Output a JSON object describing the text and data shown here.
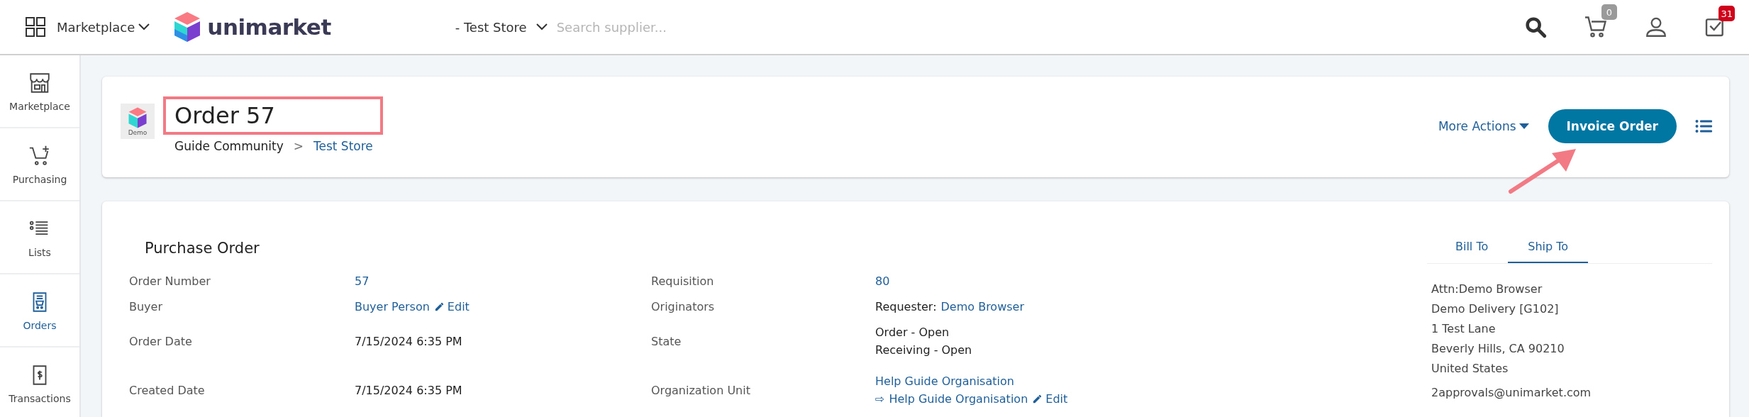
{
  "topbar": {
    "app_menu": "Marketplace",
    "brand": "unimarket",
    "store": "- Test Store",
    "search": {
      "placeholder": "Search supplier..."
    },
    "cart_count": "0",
    "task_count": "31"
  },
  "sidebar": {
    "items": [
      {
        "label": "Marketplace",
        "kind": "store",
        "selected": false
      },
      {
        "label": "Purchasing",
        "kind": "cart",
        "selected": false
      },
      {
        "label": "Lists",
        "kind": "list",
        "selected": false
      },
      {
        "label": "Orders",
        "kind": "orders",
        "selected": true
      },
      {
        "label": "Transactions",
        "kind": "money",
        "selected": false
      }
    ]
  },
  "header": {
    "logo_caption": "Demo",
    "title": "Order 57",
    "title_highlighted": true,
    "breadcrumb": [
      {
        "text": "Guide Community",
        "kind": "text"
      },
      {
        "text": ">",
        "kind": "separator"
      },
      {
        "text": "Test Store",
        "kind": "link"
      }
    ],
    "more_actions": "More Actions",
    "primary_button": "Invoice Order",
    "arrow_annotation": true
  },
  "details": {
    "heading": "Purchase Order",
    "columns": [
      {
        "fields": [
          {
            "label": "Order Number",
            "lines": [
              [
                {
                  "text": "57",
                  "kind": "link"
                }
              ]
            ]
          },
          {
            "label": "Buyer",
            "lines": [
              [
                {
                  "text": "Buyer Person",
                  "kind": "link"
                },
                {
                  "text": "Edit",
                  "kind": "edit"
                }
              ]
            ]
          },
          {
            "label": "Order Date",
            "lines": [
              [
                {
                  "text": "7/15/2024 6:35 PM",
                  "kind": "text"
                }
              ]
            ]
          },
          {
            "label": "Created Date",
            "lines": [
              [
                {
                  "text": "7/15/2024 6:35 PM",
                  "kind": "text"
                }
              ]
            ]
          }
        ]
      },
      {
        "fields": [
          {
            "label": "Requisition",
            "lines": [
              [
                {
                  "text": "80",
                  "kind": "link"
                }
              ]
            ]
          },
          {
            "label": "Originators",
            "lines": [
              [
                {
                  "text": "Requester:",
                  "kind": "text"
                },
                {
                  "text": "Demo Browser",
                  "kind": "link"
                }
              ]
            ]
          },
          {
            "label": "State",
            "lines": [
              [
                {
                  "text": "Order - Open",
                  "kind": "text"
                }
              ],
              [
                {
                  "text": "Receiving - Open",
                  "kind": "text"
                }
              ]
            ]
          },
          {
            "label": "Organization Unit",
            "lines": [
              [
                {
                  "text": "Help Guide Organisation",
                  "kind": "link"
                }
              ],
              [
                {
                  "text": "⇨",
                  "kind": "link"
                },
                {
                  "text": "Help Guide Organisation",
                  "kind": "link"
                },
                {
                  "text": "Edit",
                  "kind": "edit"
                }
              ]
            ]
          }
        ]
      }
    ]
  },
  "address": {
    "tabs": [
      {
        "label": "Bill To",
        "selected": false
      },
      {
        "label": "Ship To",
        "selected": true
      }
    ],
    "lines": [
      "Attn:Demo Browser",
      "Demo Delivery [G102]",
      "1 Test Lane",
      "Beverly Hills, CA 90210",
      "United States"
    ],
    "email": "2approvals@unimarket.com"
  }
}
